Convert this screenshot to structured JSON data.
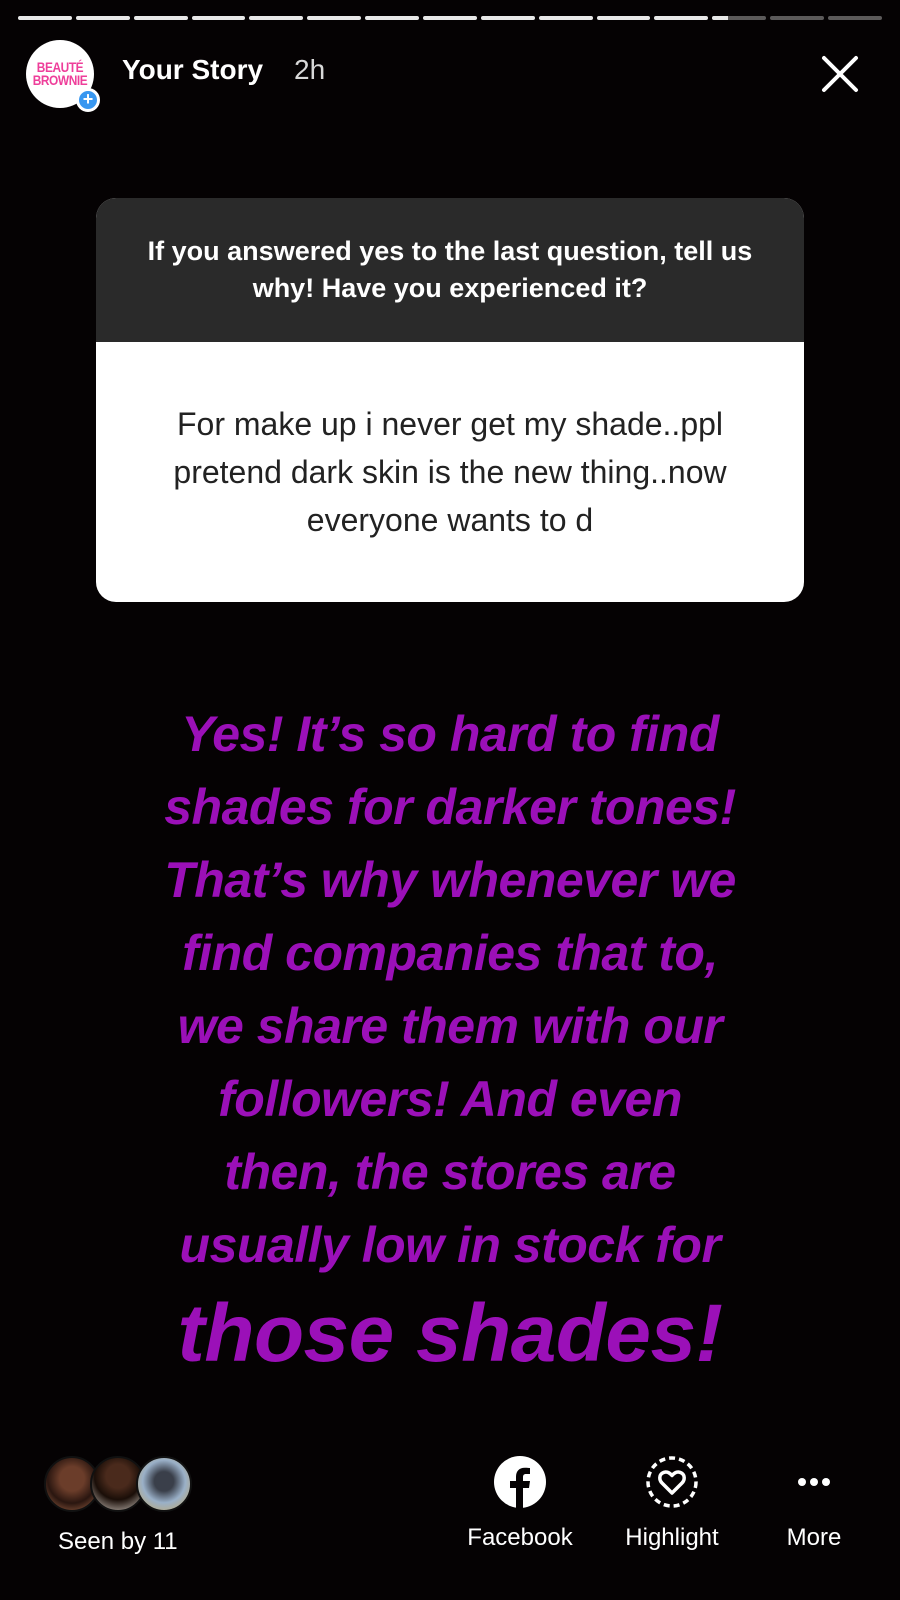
{
  "progress": {
    "segments": [
      1,
      1,
      1,
      1,
      1,
      1,
      1,
      1,
      1,
      1,
      1,
      1,
      0.3,
      0,
      0
    ],
    "active_color": "#e8e8e8"
  },
  "header": {
    "avatar_text": "BEAUTÉ BROWNIE",
    "title": "Your Story",
    "time": "2h",
    "close_icon": "close-icon"
  },
  "question": {
    "prompt": "If you answered yes to the last question, tell us why! Have you experienced it?",
    "answer": "For make up i never get my shade..ppl pretend dark skin is the new thing..now everyone wants to d"
  },
  "reply": {
    "lines": [
      "Yes! It’s so hard to find",
      "shades for darker tones!",
      "That’s why whenever we",
      "find companies that to,",
      "we share them with our",
      "followers! And even",
      "then, the stores are",
      "usually low in stock for"
    ],
    "last_line": "those shades!",
    "color": "#9b10b8"
  },
  "footer": {
    "seen_by": "Seen by 11",
    "actions": {
      "facebook": "Facebook",
      "highlight": "Highlight",
      "more": "More"
    }
  }
}
